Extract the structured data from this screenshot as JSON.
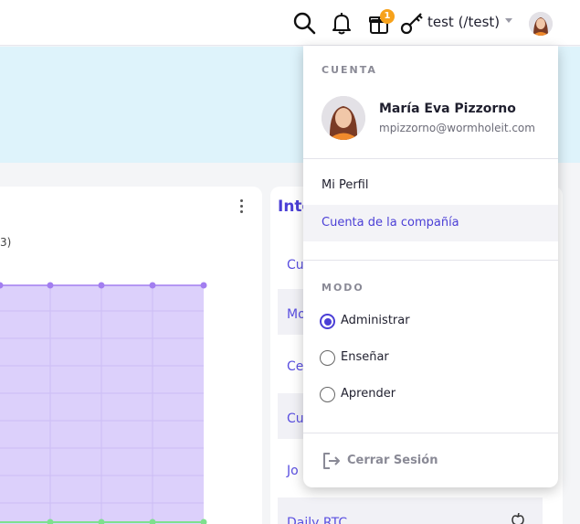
{
  "topbar": {
    "notification_count": "1",
    "tenant_label": "test (/test)"
  },
  "left_card": {
    "legend_fragment": "3)"
  },
  "right_card": {
    "title": "Inte",
    "rows": [
      "Cu",
      "Mo",
      "Ce",
      "Cu",
      "Jo",
      "Daily RTC"
    ]
  },
  "dropdown": {
    "account_section_title": "CUENTA",
    "user_name": "María Eva Pizzorno",
    "user_email": "mpizzorno@wormholeit.com",
    "menu_items": [
      {
        "label": "Mi Perfil",
        "active": false
      },
      {
        "label": "Cuenta de la compañía",
        "active": true
      }
    ],
    "mode_section_title": "MODO",
    "modes": [
      {
        "label": "Administrar",
        "selected": true
      },
      {
        "label": "Enseñar",
        "selected": false
      },
      {
        "label": "Aprender",
        "selected": false
      }
    ],
    "logout_label": "Cerrar Sesión"
  },
  "colors": {
    "accent": "#4b3fd6",
    "badge": "#f7a21b",
    "banner": "#def3fb",
    "chart_fill": "#dcd0fb",
    "chart_line": "#a27ef0",
    "chart_bottom_line": "#7ee08e"
  },
  "icons": [
    "search-icon",
    "bell-icon",
    "gift-icon",
    "key-icon",
    "chevron-down-icon",
    "kebab-menu-icon",
    "logout-icon",
    "apple-icon"
  ]
}
